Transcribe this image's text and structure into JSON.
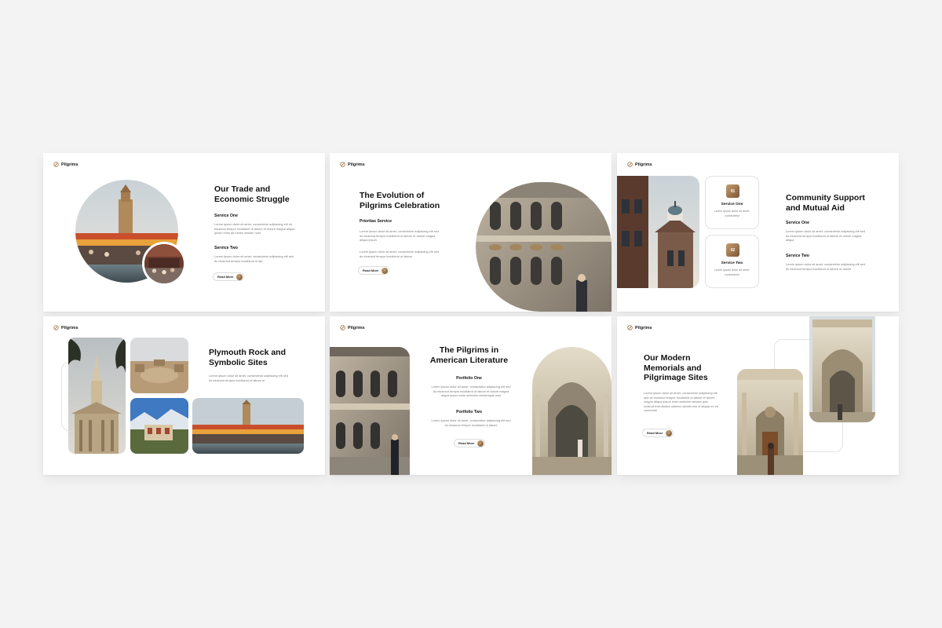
{
  "brand": {
    "name": "Pilgrims"
  },
  "colors": {
    "accent_gold": "#a5794c",
    "background": "#f3f3f3",
    "title": "#111111",
    "body_text": "#7b7b7b"
  },
  "read_more": {
    "label": "Read More",
    "icon": "arrow-right-icon"
  },
  "slides": [
    {
      "title": "Our Trade and\nEconomic Struggle",
      "blocks": [
        {
          "heading": "Service One",
          "text": "Lorem ipsum dolor sit amet, consectetur adipiscing elit do eiusmod tempor incididunt ut labore et dolore magna aliqua ipsum enim ad minim veniam nost"
        },
        {
          "heading": "Service Two",
          "text": "Lorem ipsum dolor sit amet, consectetur adipiscing elit sed do eiusmod tempor incididunt ut lab"
        }
      ]
    },
    {
      "title": "The Evolution of\nPilgrims Celebration",
      "heading": "Prioritas Service",
      "paragraphs": [
        "Lorem ipsum dolor sit amet, consectetur adipiscing elit sed do eiusmod tempor incididunt ut labore et dolore magna aliqua ipsum",
        "Lorem ipsum dolor sit amet, consectetur adipiscing elit sed do eiusmod tempor incididunt ut labore"
      ]
    },
    {
      "title": "Community Support\nand Mutual Aid",
      "cards": [
        {
          "number": "01",
          "title": "Service One",
          "text": "Lorem ipsum dolor sit amet, consectetur"
        },
        {
          "number": "02",
          "title": "Service Two",
          "text": "Lorem ipsum dolor sit amet, consectetur"
        }
      ],
      "blocks": [
        {
          "heading": "Service One",
          "text": "Lorem ipsum dolor sit amet, consectetur adipiscing elit sed do eiusmod tempor incididunt ut labore et dolore magna aliqua"
        },
        {
          "heading": "Service Two",
          "text": "Lorem ipsum dolor sit amet, consectetur adipiscing elit sed do eiusmod tempor incididunt ut labore et dolore"
        }
      ]
    },
    {
      "title": "Plymouth Rock and\nSymbolic Sites",
      "text": "Lorem ipsum dolor sit amet, consectetur adipiscing elit sed do eiusmod tempor incididunt ut labore et"
    },
    {
      "title": "The Pilgrims in\nAmerican Literature",
      "blocks": [
        {
          "heading": "Portfolio One",
          "text": "Lorem ipsum dolor sit amet, consectetur adipiscing elit sed do eiusmod tempor incididunt ut labore et dolore magna aliqua ipsum enim adminim veniamquis nost"
        },
        {
          "heading": "Portfolio Two",
          "text": "Lorem ipsum dolor sit amet, consectetur adipiscing elit sed do eiusmod tempor incididunt ut labore"
        }
      ]
    },
    {
      "title": "Our Modern\nMemorials and\nPilgrimage Sites",
      "text": "Lorem ipsum dolor sit amet, consectetur adipiscing elit sed do eiusmod tempor incididunt ut labore et dolore magna aliqua ipsum enim adminim veniam quis nostrud exercitation ullamco laboris nisi ut aliquip ex ea commodo"
    }
  ]
}
